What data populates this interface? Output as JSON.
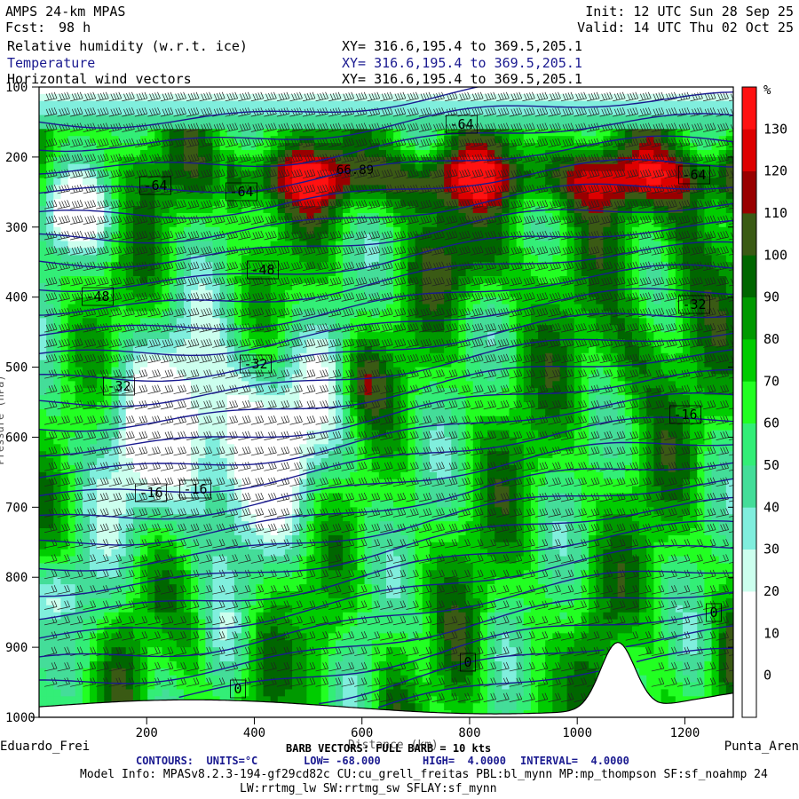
{
  "header": {
    "model_name": "AMPS 24-km MPAS",
    "forecast_label": "Fcst:",
    "forecast_hours": "98 h",
    "init_time": "Init: 12 UTC Sun 28 Sep 25",
    "valid_time": "Valid: 14 UTC Thu 02 Oct 25",
    "fields": [
      {
        "name": "Relative humidity (w.r.t. ice)",
        "xy": "XY= 316.6,195.4 to 369.5,205.1"
      },
      {
        "name": "Temperature",
        "xy": "XY= 316.6,195.4 to 369.5,205.1"
      },
      {
        "name": "Horizontal wind vectors",
        "xy": "XY= 316.6,195.4 to 369.5,205.1"
      }
    ]
  },
  "chart_data": {
    "type": "heatmap",
    "title": "Relative humidity (w.r.t. ice) / Temperature / Horizontal wind vectors cross section",
    "xlabel": "Distance (km)",
    "ylabel": "Pressure (hPa)",
    "xlim": [
      0,
      1290
    ],
    "ylim": [
      1000,
      100
    ],
    "x_ticks": [
      200,
      400,
      600,
      800,
      1000,
      1200
    ],
    "y_ticks": [
      100,
      200,
      300,
      400,
      500,
      600,
      700,
      800,
      900,
      1000
    ],
    "left_endpoint": "Eduardo_Frei",
    "right_endpoint": "Punta_Aren",
    "colorbar": {
      "unit": "%",
      "levels": [
        0,
        10,
        20,
        30,
        40,
        50,
        60,
        70,
        80,
        90,
        100,
        110,
        120,
        130
      ],
      "colors": [
        "#ffffff",
        "#ffffff",
        "#ffffff",
        "#ccffee",
        "#80eedd",
        "#44dd99",
        "#33ee77",
        "#22ff22",
        "#00cc00",
        "#009900",
        "#006600",
        "#3a5a14",
        "#990000",
        "#dd0000",
        "#ff1111"
      ]
    },
    "temperature_contour_labels": [
      "-64",
      "-64",
      "-64",
      "-64",
      "-48",
      "-48",
      "-32",
      "-32",
      "-32",
      "-16",
      "-16",
      "-16",
      "0",
      "0",
      "0"
    ],
    "rh_max_label": "66.89",
    "barb_info": "BARB VECTORS: FULL BARB = 10 kts",
    "contour_info": {
      "units": "CONTOURS:  UNITS=°C",
      "low": "LOW= -68.000",
      "high": "HIGH=  4.0000",
      "interval": "INTERVAL=  4.0000"
    }
  },
  "footer": {
    "model_info": "Model Info: MPASv8.2.3-194-gf29cd82c CU:cu_grell_freitas PBL:bl_mynn MP:mp_thompson SF:sf_noahmp 24",
    "model_info_2": "LW:rrtmg_lw SW:rrtmg_sw SFLAY:sf_mynn"
  },
  "colors": {
    "contour": "#1a1a90",
    "frame": "#000000"
  }
}
